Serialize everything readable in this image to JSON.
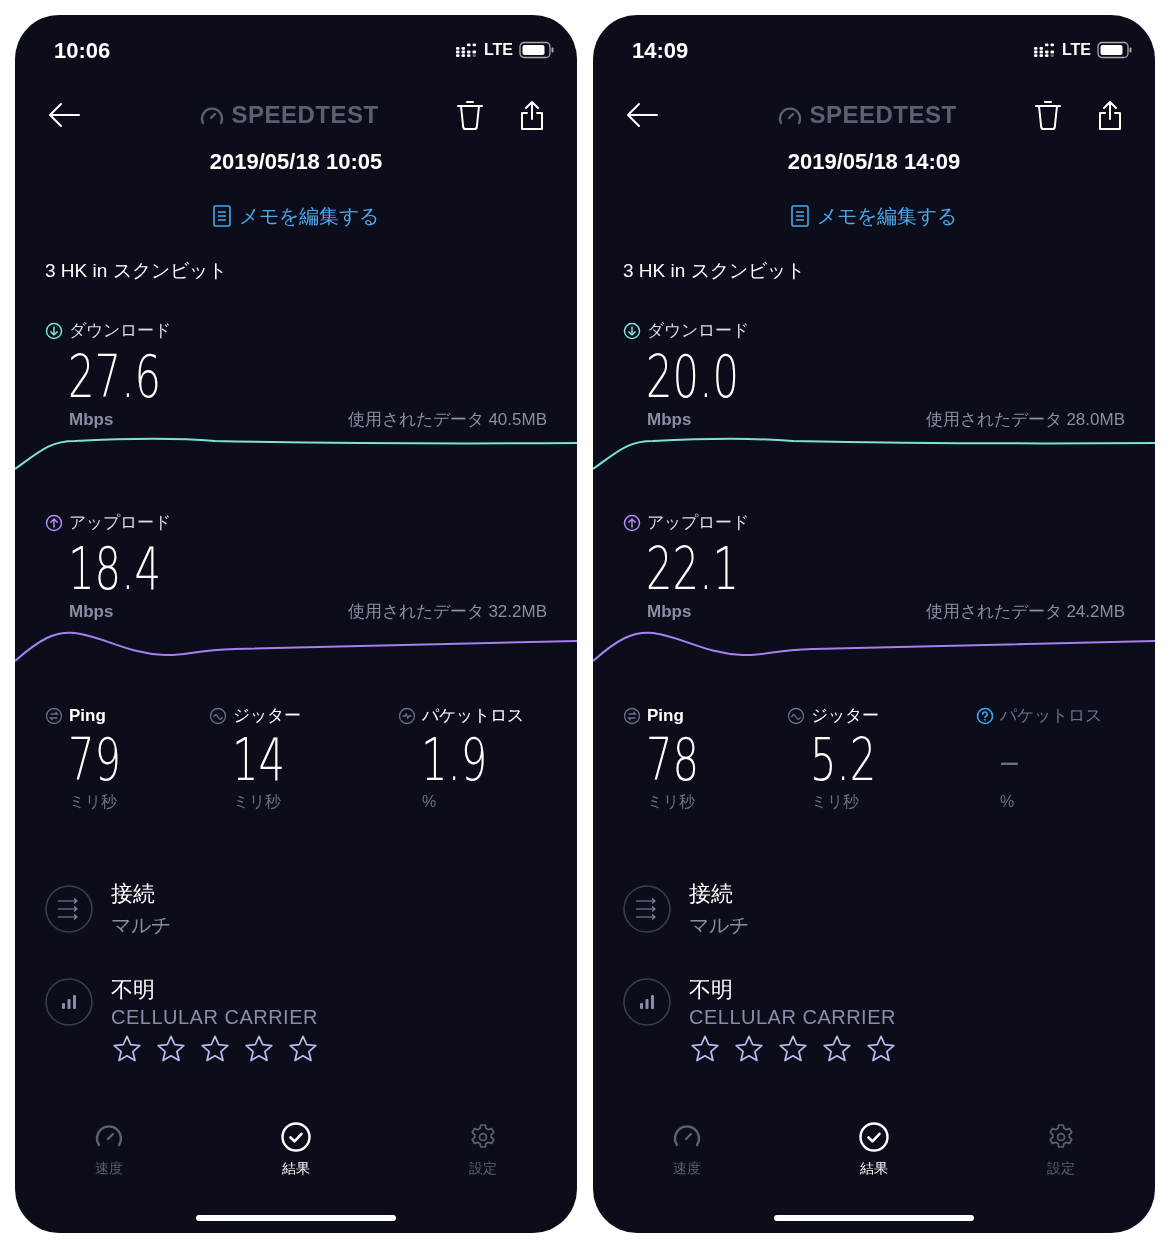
{
  "phones": [
    {
      "status_time": "10:06",
      "network": "LTE",
      "logo": "SPEEDTEST",
      "date": "2019/05/18 10:05",
      "memo_link": "メモを編集する",
      "server": "3 HK in スクンビット",
      "metrics": [
        {
          "kind": "download",
          "label": "ダウンロード",
          "value": "27.6",
          "unit": "Mbps",
          "data_used": "使用されたデータ 40.5MB"
        },
        {
          "kind": "upload",
          "label": "アップロード",
          "value": "18.4",
          "unit": "Mbps",
          "data_used": "使用されたデータ 32.2MB"
        }
      ],
      "stats": [
        {
          "kind": "ping",
          "label": "Ping",
          "value": "79",
          "unit": "ミリ秒",
          "available": true
        },
        {
          "kind": "jitter",
          "label": "ジッター",
          "value": "14",
          "unit": "ミリ秒",
          "available": true
        },
        {
          "kind": "packet_loss",
          "label": "パケットロス",
          "value": "1.9",
          "unit": "%",
          "available": true
        }
      ],
      "connection": {
        "title": "接続",
        "value": "マルチ"
      },
      "carrier": {
        "title": "不明",
        "subtitle": "CELLULAR CARRIER",
        "stars": 0
      },
      "tabs": [
        {
          "kind": "speed",
          "label": "速度",
          "selected": false
        },
        {
          "kind": "results",
          "label": "結果",
          "selected": true
        },
        {
          "kind": "settings",
          "label": "設定",
          "selected": false
        }
      ]
    },
    {
      "status_time": "14:09",
      "network": "LTE",
      "logo": "SPEEDTEST",
      "date": "2019/05/18 14:09",
      "memo_link": "メモを編集する",
      "server": "3 HK in スクンビット",
      "metrics": [
        {
          "kind": "download",
          "label": "ダウンロード",
          "value": "20.0",
          "unit": "Mbps",
          "data_used": "使用されたデータ 28.0MB"
        },
        {
          "kind": "upload",
          "label": "アップロード",
          "value": "22.1",
          "unit": "Mbps",
          "data_used": "使用されたデータ 24.2MB"
        }
      ],
      "stats": [
        {
          "kind": "ping",
          "label": "Ping",
          "value": "78",
          "unit": "ミリ秒",
          "available": true
        },
        {
          "kind": "jitter",
          "label": "ジッター",
          "value": "5.2",
          "unit": "ミリ秒",
          "available": true
        },
        {
          "kind": "packet_loss",
          "label": "パケットロス",
          "value": "–",
          "unit": "%",
          "available": false
        }
      ],
      "connection": {
        "title": "接続",
        "value": "マルチ"
      },
      "carrier": {
        "title": "不明",
        "subtitle": "CELLULAR CARRIER",
        "stars": 0
      },
      "tabs": [
        {
          "kind": "speed",
          "label": "速度",
          "selected": false
        },
        {
          "kind": "results",
          "label": "結果",
          "selected": true
        },
        {
          "kind": "settings",
          "label": "設定",
          "selected": false
        }
      ]
    }
  ]
}
